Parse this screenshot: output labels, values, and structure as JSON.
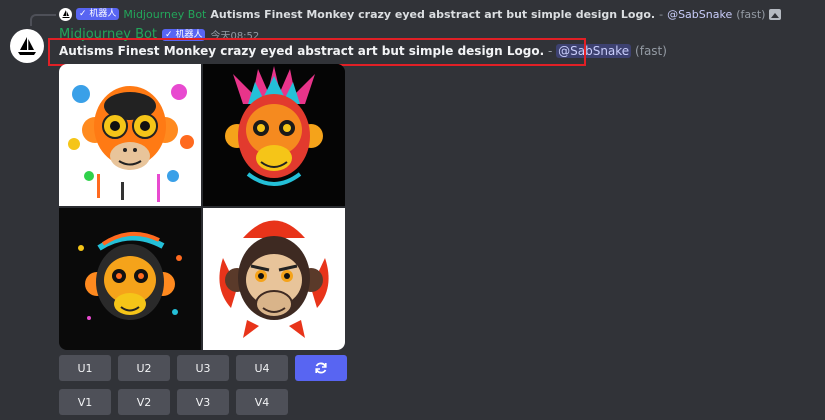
{
  "reply": {
    "tag_label": "✓ 机器人",
    "username": "Midjourney Bot",
    "prompt": "Autisms Finest Monkey crazy eyed abstract art but simple design Logo.",
    "separator": " - ",
    "mention": "@SabSnake",
    "speed": "(fast)",
    "attachment_icon": "image-icon"
  },
  "message": {
    "author": "Midjourney Bot",
    "tag_label": "✓ 机器人",
    "timestamp": "今天08:52",
    "prompt": "Autisms Finest Monkey crazy eyed abstract art but simple design Logo.",
    "separator": " - ",
    "mention": "@SabSnake",
    "speed": "(fast)"
  },
  "upscale_buttons": [
    "U1",
    "U2",
    "U3",
    "U4"
  ],
  "variation_buttons": [
    "V1",
    "V2",
    "V3",
    "V4"
  ],
  "reroll_icon": "refresh-icon",
  "colors": {
    "background": "#313338",
    "bot_name": "#23a55a",
    "bot_tag": "#5865f2",
    "button": "#4e5058",
    "reroll_button": "#5865f2",
    "highlight": "#e12026"
  }
}
